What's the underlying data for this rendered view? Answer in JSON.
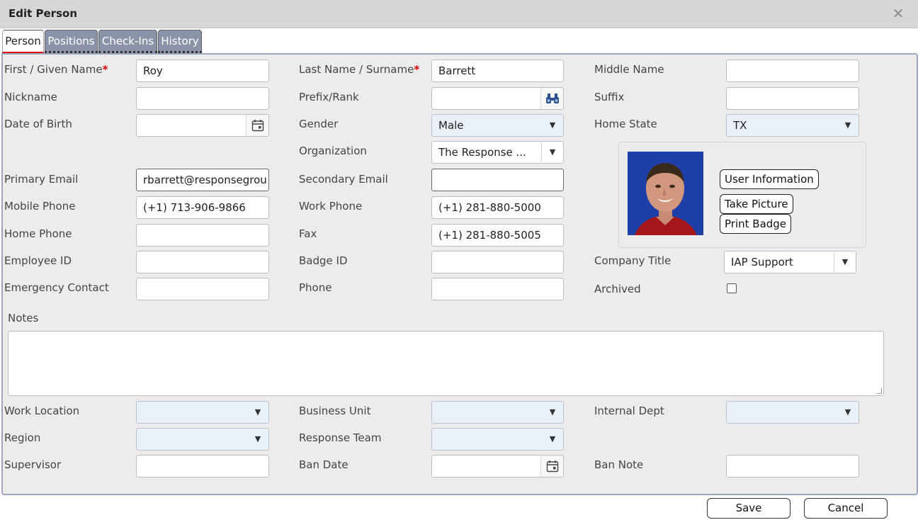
{
  "window": {
    "title": "Edit Person",
    "close_glyph": "✕"
  },
  "tabs": [
    {
      "label": "Person",
      "active": true
    },
    {
      "label": "Positions",
      "active": false
    },
    {
      "label": "Check-Ins",
      "active": false
    },
    {
      "label": "History",
      "active": false
    }
  ],
  "labels": {
    "first_name": "First / Given Name",
    "last_name": "Last Name / Surname",
    "required_mark": "*",
    "middle_name": "Middle Name",
    "nickname": "Nickname",
    "prefix": "Prefix/Rank",
    "suffix": "Suffix",
    "dob": "Date of Birth",
    "gender": "Gender",
    "home_state": "Home State",
    "organization": "Organization",
    "primary_email": "Primary Email",
    "secondary_email": "Secondary Email",
    "mobile_phone": "Mobile Phone",
    "work_phone": "Work Phone",
    "home_phone": "Home Phone",
    "fax": "Fax",
    "employee_id": "Employee ID",
    "badge_id": "Badge ID",
    "company_title": "Company Title",
    "emergency_contact": "Emergency Contact",
    "phone": "Phone",
    "archived": "Archived",
    "notes": "Notes",
    "work_location": "Work Location",
    "business_unit": "Business Unit",
    "internal_dept": "Internal Dept",
    "region": "Region",
    "response_team": "Response Team",
    "supervisor": "Supervisor",
    "ban_date": "Ban Date",
    "ban_note": "Ban Note"
  },
  "values": {
    "first_name": "Roy",
    "last_name": "Barrett",
    "middle_name": "",
    "nickname": "",
    "prefix": "",
    "suffix": "",
    "dob": "",
    "gender": "Male",
    "home_state": "TX",
    "organization": "The Response ...",
    "primary_email": "rbarrett@responsegrou",
    "secondary_email": "",
    "mobile_phone": "(+1) 713-906-9866",
    "work_phone": "(+1) 281-880-5000",
    "home_phone": "",
    "fax": "(+1) 281-880-5005",
    "employee_id": "",
    "badge_id": "",
    "company_title": "IAP Support",
    "emergency_contact": "",
    "phone": "",
    "archived": false,
    "notes": "",
    "work_location": "",
    "business_unit": "",
    "internal_dept": "",
    "region": "",
    "response_team": "",
    "supervisor": "",
    "ban_date": "",
    "ban_note": ""
  },
  "photo_actions": {
    "user_information": "User Information",
    "take_picture": "Take Picture",
    "print_badge": "Print Badge"
  },
  "footer": {
    "save": "Save",
    "cancel": "Cancel"
  },
  "icons": {
    "calendar": "calendar-icon",
    "lookup": "binoculars-icon",
    "dropdown": "▼"
  },
  "colors": {
    "titlebar": "#d6d6d6",
    "tab_inactive": "#8a93a8",
    "panel": "#edebeb",
    "required": "#dd0000",
    "select_bg": "#eaf0f8"
  }
}
